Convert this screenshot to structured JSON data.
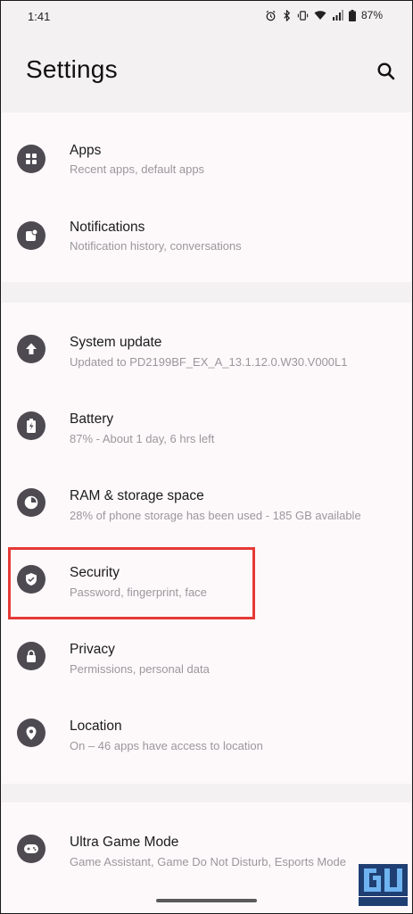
{
  "status_bar": {
    "time": "1:41",
    "battery": "87%"
  },
  "header": {
    "title": "Settings"
  },
  "items": [
    {
      "label": "Apps",
      "sub": "Recent apps, default apps",
      "icon": "apps-icon"
    },
    {
      "label": "Notifications",
      "sub": "Notification history, conversations",
      "icon": "notifications-icon"
    },
    {
      "label": "System update",
      "sub": "Updated to PD2199BF_EX_A_13.1.12.0.W30.V000L1",
      "icon": "system-update-icon"
    },
    {
      "label": "Battery",
      "sub": "87% - About 1 day, 6 hrs left",
      "icon": "battery-icon"
    },
    {
      "label": "RAM & storage space",
      "sub": "28% of phone storage has been used - 185 GB available",
      "icon": "storage-icon"
    },
    {
      "label": "Security",
      "sub": "Password, fingerprint, face",
      "icon": "security-icon"
    },
    {
      "label": "Privacy",
      "sub": "Permissions, personal data",
      "icon": "privacy-icon"
    },
    {
      "label": "Location",
      "sub": "On – 46 apps have access to location",
      "icon": "location-icon"
    },
    {
      "label": "Ultra Game Mode",
      "sub": "Game Assistant, Game Do Not Disturb, Esports Mode",
      "icon": "game-icon"
    }
  ],
  "watermark": {
    "text": "GADGETS TO USE"
  }
}
